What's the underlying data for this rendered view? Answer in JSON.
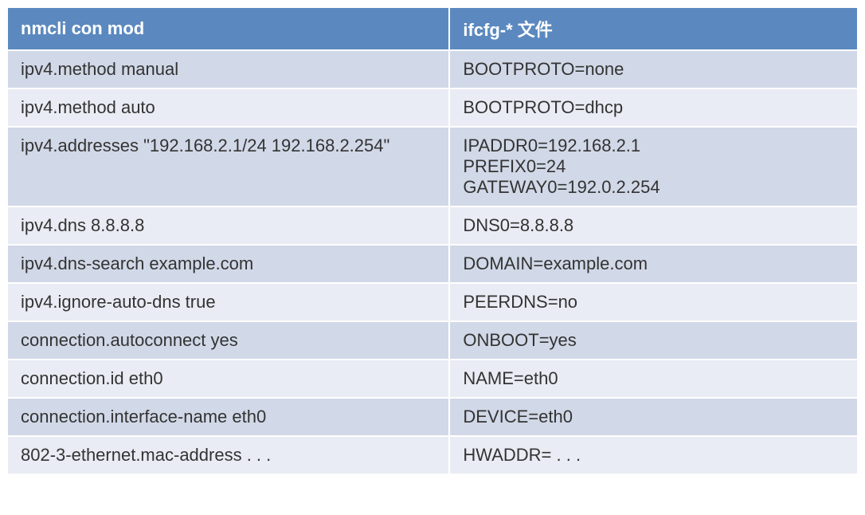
{
  "table": {
    "headers": {
      "col1": "nmcli con mod",
      "col2": "ifcfg-* 文件"
    },
    "rows": [
      {
        "col1": "ipv4.method manual",
        "col2": "BOOTPROTO=none"
      },
      {
        "col1": "ipv4.method auto",
        "col2": "BOOTPROTO=dhcp"
      },
      {
        "col1": "ipv4.addresses \"192.168.2.1/24 192.168.2.254\"",
        "col2": "IPADDR0=192.168.2.1\nPREFIX0=24\nGATEWAY0=192.0.2.254"
      },
      {
        "col1": "ipv4.dns 8.8.8.8",
        "col2": "DNS0=8.8.8.8"
      },
      {
        "col1": "ipv4.dns-search example.com",
        "col2": "DOMAIN=example.com"
      },
      {
        "col1": "ipv4.ignore-auto-dns true",
        "col2": "PEERDNS=no"
      },
      {
        "col1": "connection.autoconnect yes",
        "col2": "ONBOOT=yes"
      },
      {
        "col1": "connection.id eth0",
        "col2": "NAME=eth0"
      },
      {
        "col1": "connection.interface-name eth0",
        "col2": "DEVICE=eth0"
      },
      {
        "col1": "802-3-ethernet.mac-address . . .",
        "col2": "HWADDR= . . ."
      }
    ]
  }
}
